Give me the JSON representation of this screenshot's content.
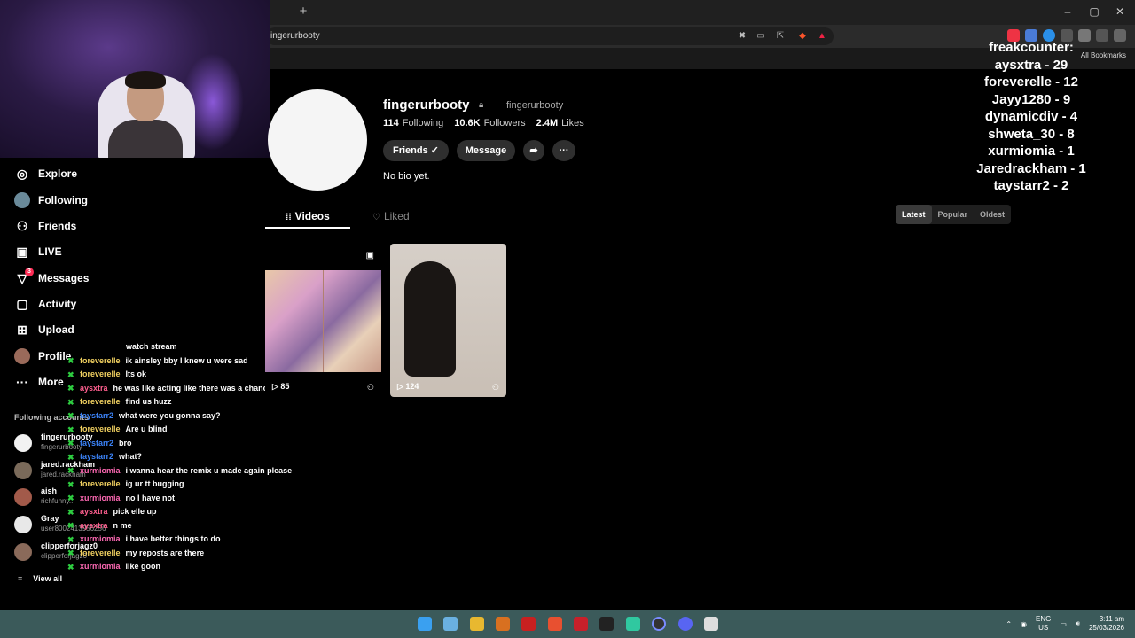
{
  "browser": {
    "new_tab": "+",
    "url": "ingerurbooty",
    "bookmarks_label": "All Bookmarks",
    "window_controls": [
      "–",
      "▢",
      "✕"
    ]
  },
  "sidebar": {
    "items": [
      {
        "label": "Explore",
        "icon": "compass-icon"
      },
      {
        "label": "Following",
        "icon": "avatar"
      },
      {
        "label": "Friends",
        "icon": "people-icon"
      },
      {
        "label": "LIVE",
        "icon": "live-icon"
      },
      {
        "label": "Messages",
        "icon": "send-icon",
        "badge": "3"
      },
      {
        "label": "Activity",
        "icon": "bell-icon"
      },
      {
        "label": "Upload",
        "icon": "upload-icon"
      },
      {
        "label": "Profile",
        "icon": "avatar"
      },
      {
        "label": "More",
        "icon": "more-icon"
      }
    ],
    "following_title": "Following accounts",
    "accounts": [
      {
        "name": "fingerurbooty",
        "handle": "fingerurbooty"
      },
      {
        "name": "jared.rackham",
        "handle": "jared.rackham"
      },
      {
        "name": "aish",
        "handle": "richfunny..."
      },
      {
        "name": "Gray",
        "handle": "user8002413956256"
      },
      {
        "name": "clipperforjagz0",
        "handle": "clipperforjagz0"
      }
    ],
    "view_all": "View all"
  },
  "chat": [
    {
      "user": "",
      "color": "#ffffff",
      "msg": "watch stream"
    },
    {
      "user": "foreverelle",
      "color": "#f0d060",
      "msg": "ik ainsley bby I knew u were sad"
    },
    {
      "user": "foreverelle",
      "color": "#f0d060",
      "msg": "Its ok"
    },
    {
      "user": "aysxtra",
      "color": "#ff5f8f",
      "msg": "he was like acting like there was a chance"
    },
    {
      "user": "foreverelle",
      "color": "#f0d060",
      "msg": "find us huzz"
    },
    {
      "user": "taystarr2",
      "color": "#3b82f6",
      "msg": "what were you gonna say?"
    },
    {
      "user": "foreverelle",
      "color": "#f0d060",
      "msg": "Are u blind"
    },
    {
      "user": "taystarr2",
      "color": "#3b82f6",
      "msg": "bro"
    },
    {
      "user": "taystarr2",
      "color": "#3b82f6",
      "msg": "what?"
    },
    {
      "user": "xurmiomia",
      "color": "#ff69b4",
      "msg": "i wanna hear the remix u made again please"
    },
    {
      "user": "foreverelle",
      "color": "#f0d060",
      "msg": "ig ur tt bugging"
    },
    {
      "user": "xurmiomia",
      "color": "#ff69b4",
      "msg": "no I have not"
    },
    {
      "user": "aysxtra",
      "color": "#ff5f8f",
      "msg": "pick elle up"
    },
    {
      "user": "aysxtra",
      "color": "#ff5f8f",
      "msg": "n me"
    },
    {
      "user": "xurmiomia",
      "color": "#ff69b4",
      "msg": "i have better things to do"
    },
    {
      "user": "foreverelle",
      "color": "#f0d060",
      "msg": "my reposts are there"
    },
    {
      "user": "xurmiomia",
      "color": "#ff69b4",
      "msg": "like goon"
    }
  ],
  "profile": {
    "username": "fingerurbooty",
    "nickname": "fingerurbooty",
    "following_count": "114",
    "following_label": "Following",
    "followers_count": "10.6K",
    "followers_label": "Followers",
    "likes_count": "2.4M",
    "likes_label": "Likes",
    "friends_button": "Friends ✓",
    "message_button": "Message",
    "share_icon": "share-icon",
    "more_icon": "more-icon",
    "bio": "No bio yet.",
    "tabs": {
      "videos": "Videos",
      "liked": "Liked"
    },
    "sort": [
      "Latest",
      "Popular",
      "Oldest"
    ],
    "videos": [
      {
        "views": "85"
      },
      {
        "views": "124"
      }
    ]
  },
  "counter": {
    "title": "freakcounter:",
    "entries": [
      "aysxtra - 29",
      "foreverelle - 12",
      "Jayy1280 - 9",
      "dynamicdiv - 4",
      "shweta_30 - 8",
      "xurmiomia - 1",
      "Jaredrackham - 1",
      "taystarr2 - 2"
    ]
  },
  "taskbar": {
    "lang_top": "ENG",
    "lang_bottom": "US",
    "time": "3:11 am",
    "date": "25/03/2026"
  },
  "colors": {
    "accent": "#fe2c55",
    "taskbar": "#3b5a5a",
    "chat_badge": "#2ecc40"
  }
}
